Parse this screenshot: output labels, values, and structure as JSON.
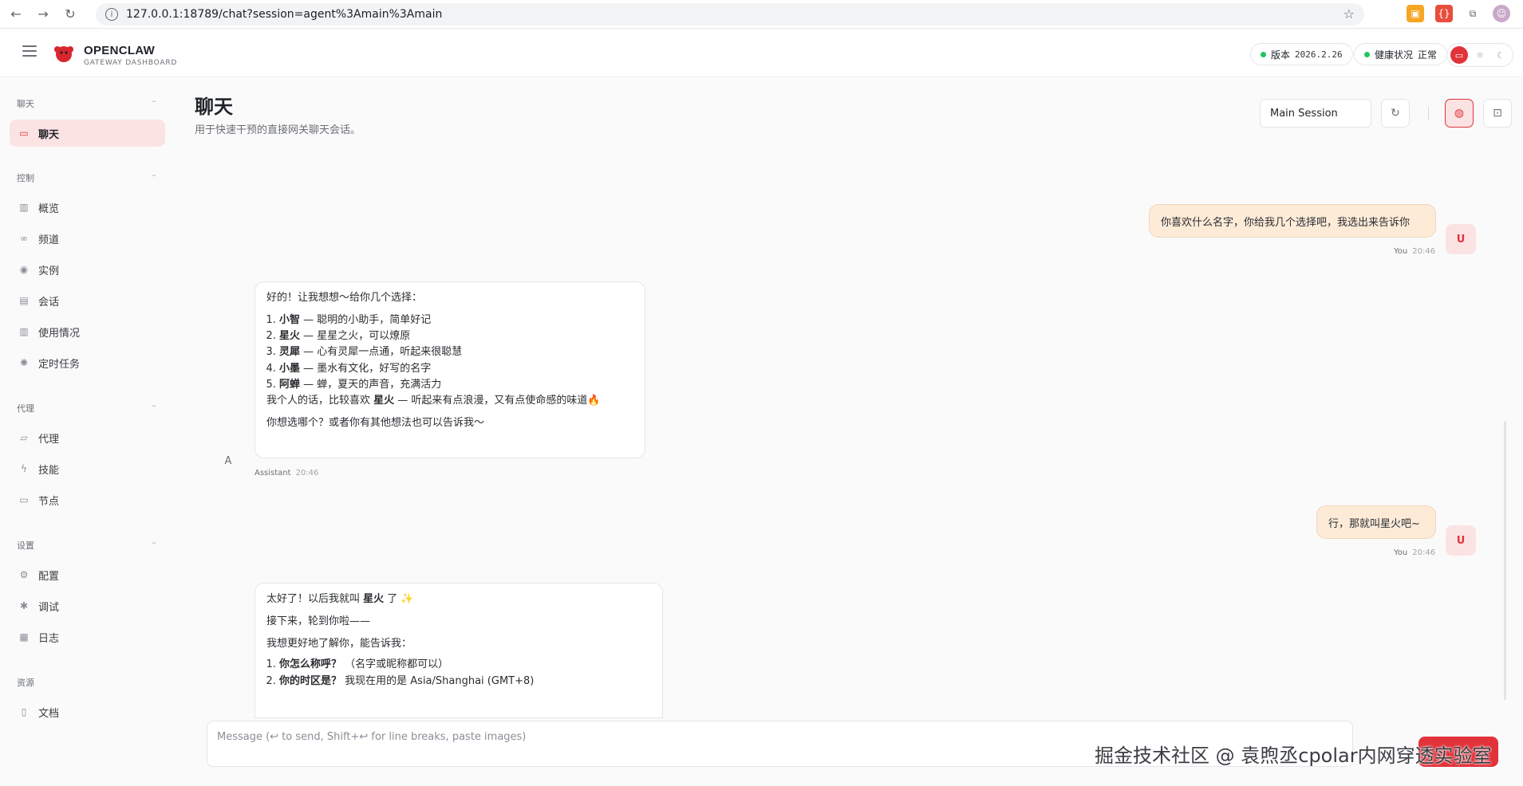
{
  "browser": {
    "url": "127.0.0.1:18789/chat?session=agent%3Amain%3Amain"
  },
  "header": {
    "brand": "OPENCLAW",
    "brand_sub": "GATEWAY DASHBOARD",
    "version_label": "版本",
    "version_value": "2026.2.26",
    "health_label": "健康状况",
    "health_value": "正常"
  },
  "sidebar": {
    "sections": [
      {
        "title": "聊天",
        "items": [
          {
            "label": "聊天",
            "icon": "chat-icon",
            "active": true
          }
        ]
      },
      {
        "title": "控制",
        "items": [
          {
            "label": "概览",
            "icon": "bar-chart-icon"
          },
          {
            "label": "频道",
            "icon": "link-icon"
          },
          {
            "label": "实例",
            "icon": "broadcast-icon"
          },
          {
            "label": "会话",
            "icon": "file-icon"
          },
          {
            "label": "使用情况",
            "icon": "bar-chart-icon"
          },
          {
            "label": "定时任务",
            "icon": "spinner-icon"
          }
        ]
      },
      {
        "title": "代理",
        "items": [
          {
            "label": "代理",
            "icon": "folder-icon"
          },
          {
            "label": "技能",
            "icon": "bolt-icon"
          },
          {
            "label": "节点",
            "icon": "monitor-icon"
          }
        ]
      },
      {
        "title": "设置",
        "items": [
          {
            "label": "配置",
            "icon": "gear-icon"
          },
          {
            "label": "调试",
            "icon": "bug-icon"
          },
          {
            "label": "日志",
            "icon": "log-icon"
          }
        ]
      },
      {
        "title": "资源",
        "items": [
          {
            "label": "文档",
            "icon": "book-icon"
          }
        ]
      }
    ]
  },
  "main": {
    "title": "聊天",
    "subtitle": "用于快速干预的直接网关聊天会话。",
    "session_select": "Main Session"
  },
  "messages": {
    "m1": {
      "text": "你喜欢什么名字，你给我几个选择吧，我选出来告诉你",
      "who": "You",
      "time": "20:46",
      "avatar": "U"
    },
    "m2": {
      "intro": "好的！让我想想～给你几个选择：",
      "options": [
        {
          "name": "小智",
          "desc": " — 聪明的小助手，简单好记"
        },
        {
          "name": "星火",
          "desc": " — 星星之火，可以燎原"
        },
        {
          "name": "灵犀",
          "desc": " — 心有灵犀一点通，听起来很聪慧"
        },
        {
          "name": "小墨",
          "desc": " — 墨水有文化，好写的名字"
        },
        {
          "name": "阿蝉",
          "desc": " — 蝉，夏天的声音，充满活力"
        }
      ],
      "pref_a": "我个人的话，比较喜欢 ",
      "pref_b": "星火",
      "pref_c": " — 听起来有点浪漫，又有点使命感的味道🔥",
      "ask": "你想选哪个？或者你有其他想法也可以告诉我～",
      "who": "Assistant",
      "time": "20:46",
      "avatar": "A"
    },
    "m3": {
      "text": "行，那就叫星火吧~",
      "who": "You",
      "time": "20:46",
      "avatar": "U"
    },
    "m4": {
      "line1_a": "太好了！以后我就叫 ",
      "line1_b": "星火",
      "line1_c": " 了 ✨",
      "line2": "接下来，轮到你啦——",
      "line3": "我想更好地了解你，能告诉我：",
      "q1_a": "你怎么称呼？",
      "q1_b": " （名字或昵称都可以）",
      "q2_a": "你的时区是？",
      "q2_b": " 我现在用的是 Asia/Shanghai (GMT+8)"
    }
  },
  "composer": {
    "placeholder": "Message (↩ to send, Shift+↩ for line breaks, paste images)"
  },
  "watermark": "掘金技术社区 @ 袁煦丞cpolar内网穿透实验室",
  "colors": {
    "accent": "#e2323a",
    "user_bubble": "#fdebd8",
    "health": "#22c55e"
  }
}
